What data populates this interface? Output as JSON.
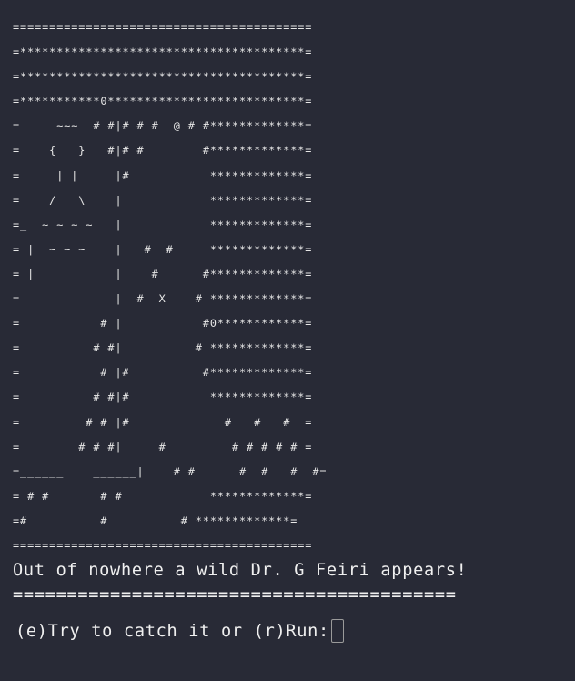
{
  "terminal": {
    "art_lines": [
      "=========================================",
      "=***************************************=",
      "=***************************************=",
      "=***********0***************************=",
      "=     ~~~  # #|# # #  @ # #*************=",
      "=    {   }   #|# #        #*************=",
      "=     | |     |#           *************=",
      "=    /   \\    |            *************=",
      "=_  ~ ~ ~ ~   |            *************=",
      "= |  ~ ~ ~    |   #  #     *************=",
      "=_|           |    #      #*************=",
      "=             |  #  X    # *************=",
      "=           # |           #0************=",
      "=          # #|          # *************=",
      "=           # |#          #*************=",
      "=          # #|#           *************=",
      "=         # # |#             #   #   #  =",
      "=        # # #|     #         # # # # # =",
      "=______    ______|    # #      #  #   #  #=",
      "= # #       # #            *************=",
      "=#          #          # *************=",
      "========================================="
    ],
    "message": "Out of nowhere a wild Dr. G Feiri appears!",
    "separator": "=========================================",
    "prompt": "(e)Try to catch it or (r)Run:",
    "input_value": ""
  }
}
